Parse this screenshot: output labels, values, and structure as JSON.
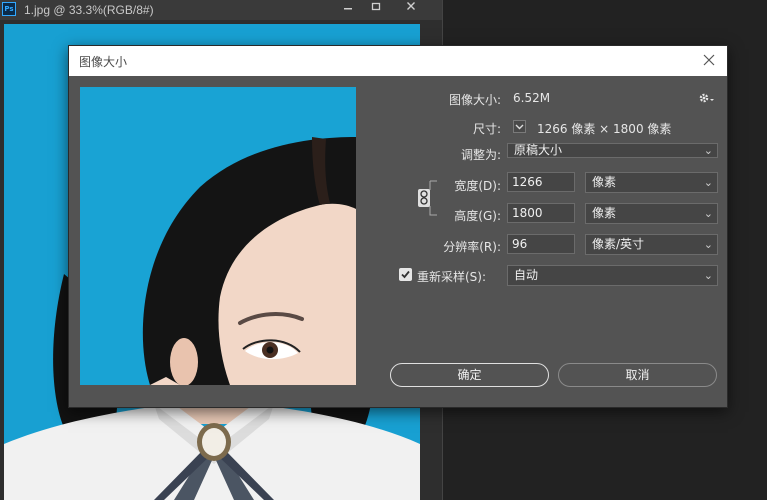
{
  "document": {
    "title": "1.jpg @ 33.3%(RGB/8#)",
    "app_icon_text": "Ps",
    "window_buttons": {
      "minimize": "▬",
      "maximize": "❐",
      "close": "✕"
    }
  },
  "dialog": {
    "title": "图像大小",
    "image_size_label": "图像大小:",
    "image_size_value": "6.52M",
    "settings_icon": "gear-icon",
    "dimensions_label": "尺寸:",
    "dimensions_value": "1266 像素 × 1800 像素",
    "fit_to_label": "调整为:",
    "fit_to_value": "原稿大小",
    "width_label": "宽度(D):",
    "width_value": "1266",
    "width_unit": "像素",
    "height_label": "高度(G):",
    "height_value": "1800",
    "height_unit": "像素",
    "resolution_label": "分辨率(R):",
    "resolution_value": "96",
    "resolution_unit": "像素/英寸",
    "resample_label": "重新采样(S):",
    "resample_checked": true,
    "resample_value": "自动",
    "ok_label": "确定",
    "cancel_label": "取消"
  },
  "colors": {
    "background_blue": "#18a0d2",
    "dialog_bg": "#535353",
    "field_bg": "#454545"
  }
}
